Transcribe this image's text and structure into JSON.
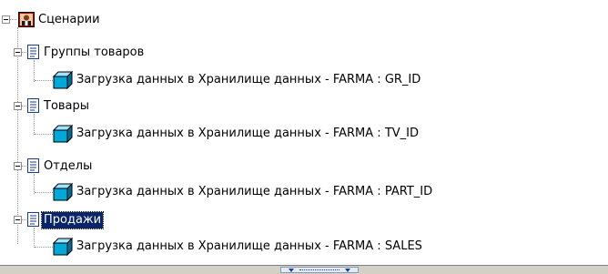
{
  "tree": {
    "root": {
      "label": "Сценарии",
      "icon": "scenario-icon",
      "expanded": true
    },
    "groups": [
      {
        "label": "Группы товаров",
        "icon": "document-icon",
        "expanded": true,
        "selected": false,
        "child": {
          "label": "Загрузка данных в Хранилище данных - FARMA : GR_ID",
          "icon": "cube-icon"
        }
      },
      {
        "label": "Товары",
        "icon": "document-icon",
        "expanded": true,
        "selected": false,
        "child": {
          "label": "Загрузка данных в Хранилище данных - FARMA : TV_ID",
          "icon": "cube-icon"
        }
      },
      {
        "label": "Отделы",
        "icon": "document-icon",
        "expanded": true,
        "selected": false,
        "child": {
          "label": "Загрузка данных в Хранилище данных - FARMA : PART_ID",
          "icon": "cube-icon"
        }
      },
      {
        "label": "Продажи",
        "icon": "document-icon",
        "expanded": true,
        "selected": true,
        "child": {
          "label": "Загрузка данных в Хранилище данных - FARMA : SALES",
          "icon": "cube-icon"
        }
      }
    ]
  },
  "colors": {
    "selection_bg": "#0a246a",
    "selection_fg": "#ffffff",
    "cube": "#00a8d8",
    "scenario_icon_bg": "#c00000"
  }
}
